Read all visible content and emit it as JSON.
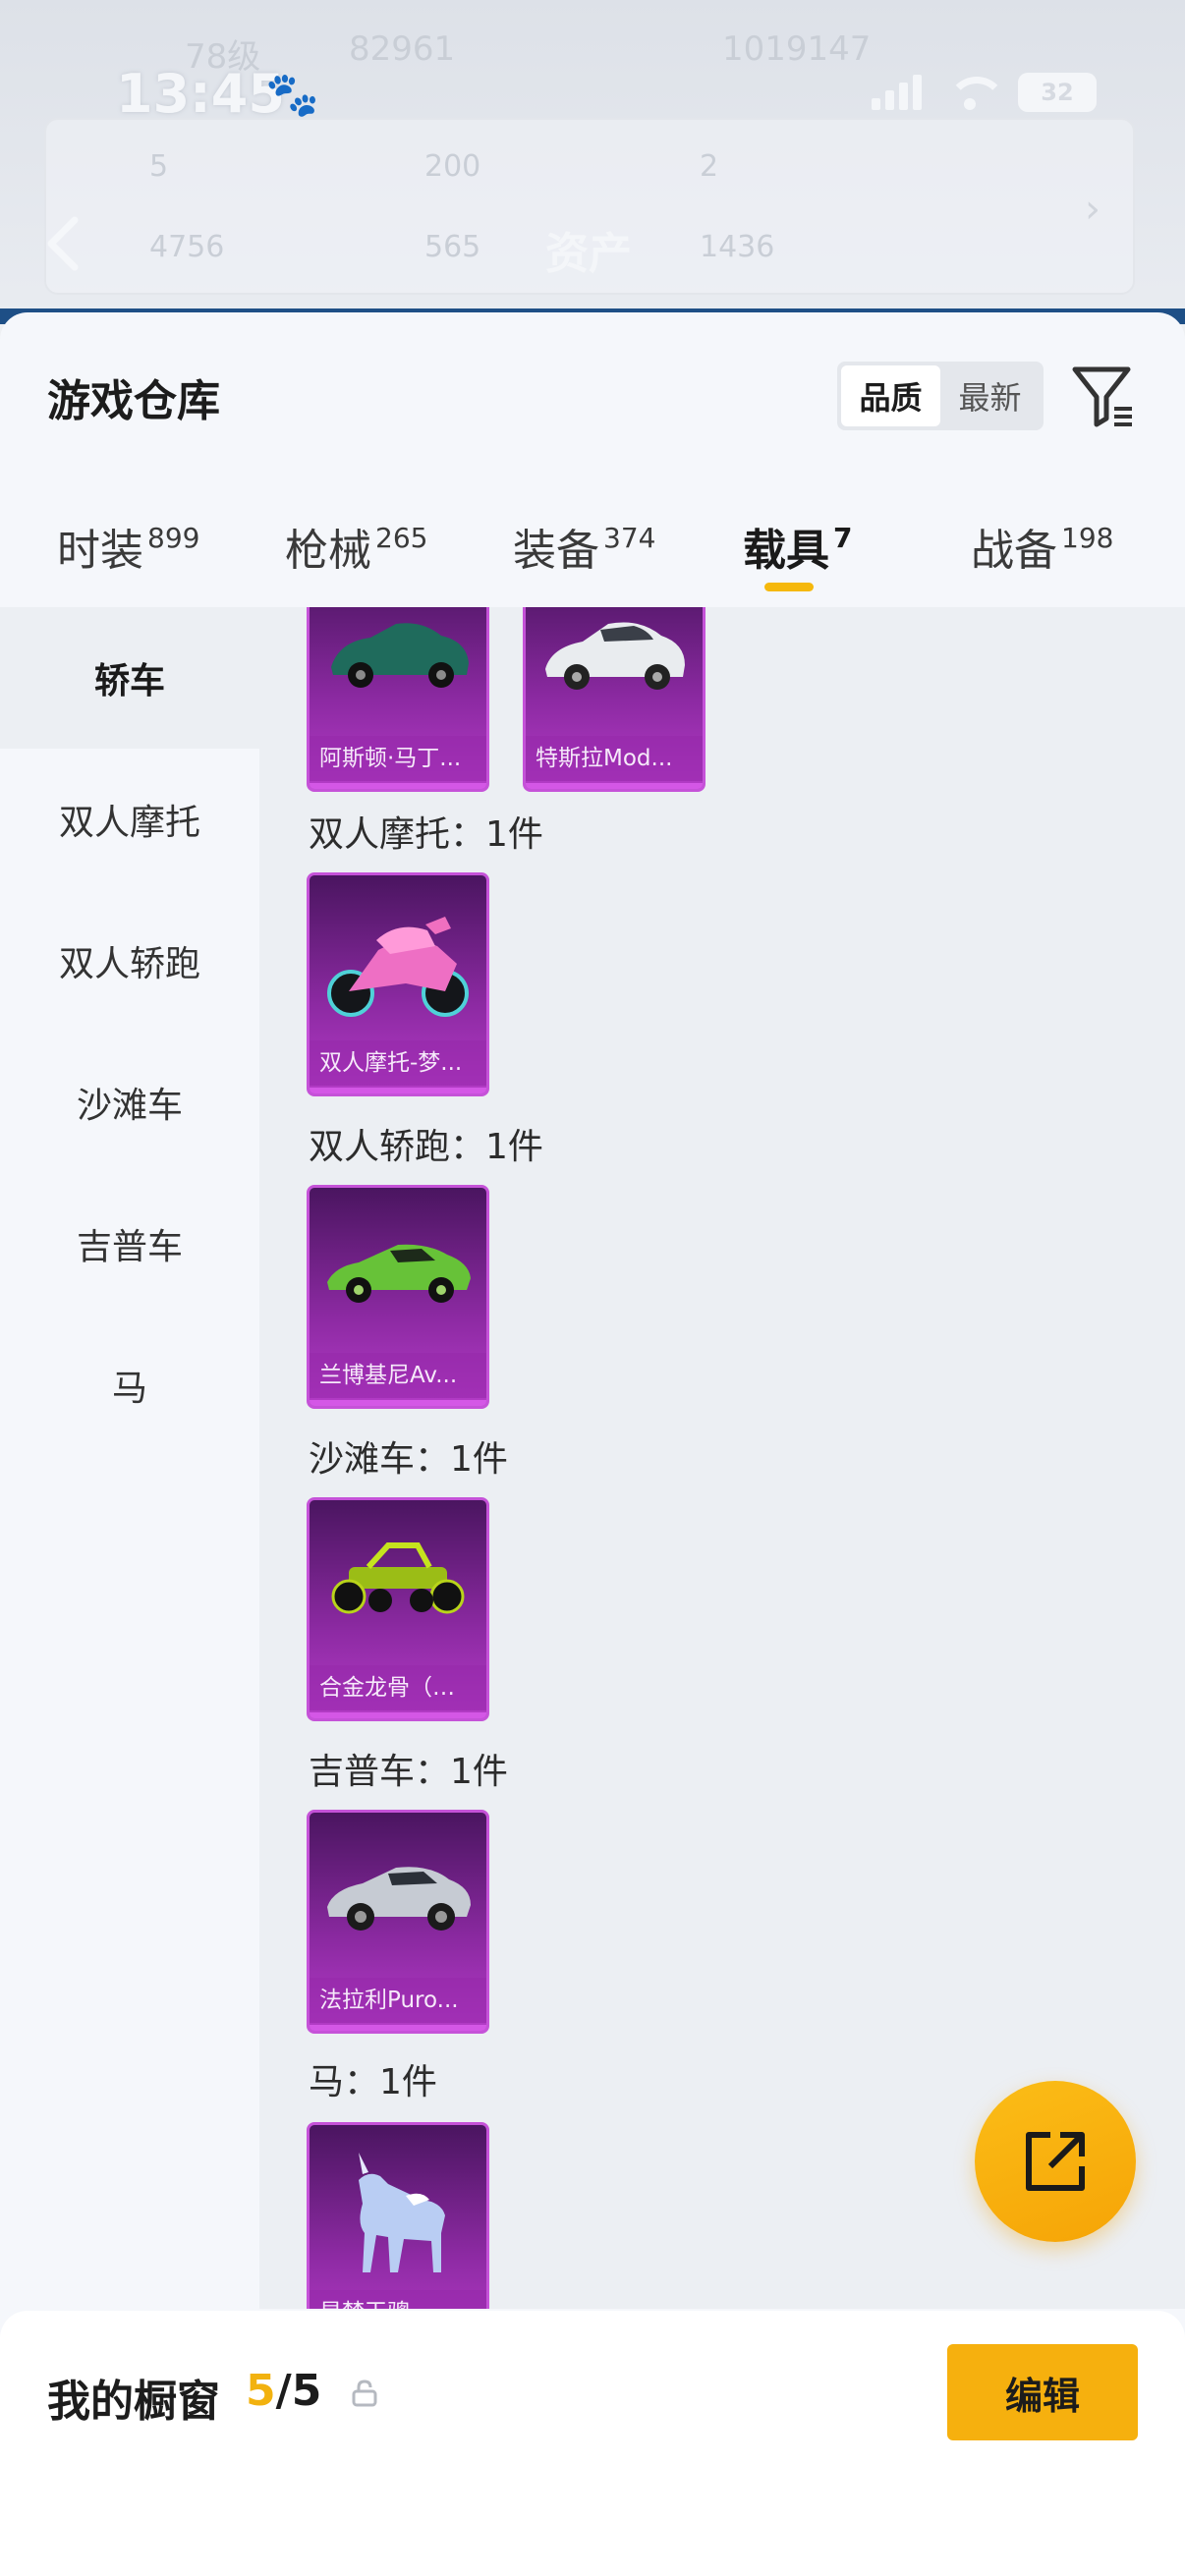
{
  "status_bar": {
    "time": "13:45",
    "battery": "32"
  },
  "background_header": {
    "title": "资产",
    "faded_values": [
      "78级",
      "82961",
      "1019147",
      "5",
      "200",
      "2",
      "4756",
      "565",
      "1436"
    ]
  },
  "sheet": {
    "title": "游戏仓库",
    "sort_options": [
      "品质",
      "最新"
    ],
    "active_sort": "品质"
  },
  "tabs": [
    {
      "label": "时装",
      "count": "899"
    },
    {
      "label": "枪械",
      "count": "265"
    },
    {
      "label": "装备",
      "count": "374"
    },
    {
      "label": "载具",
      "count": "7",
      "active": true
    },
    {
      "label": "战备",
      "count": "198"
    }
  ],
  "sidebar": {
    "items": [
      "轿车",
      "双人摩托",
      "双人轿跑",
      "沙滩车",
      "吉普车",
      "马"
    ],
    "active": "轿车"
  },
  "groups": [
    {
      "label": "",
      "items": [
        "阿斯顿·马丁...",
        "特斯拉Mod..."
      ]
    },
    {
      "label": "双人摩托：1件",
      "items": [
        "双人摩托-梦..."
      ]
    },
    {
      "label": "双人轿跑：1件",
      "items": [
        "兰博基尼Av..."
      ]
    },
    {
      "label": "沙滩车：1件",
      "items": [
        "合金龙骨（绿）"
      ]
    },
    {
      "label": "吉普车：1件",
      "items": [
        "法拉利Puro..."
      ]
    },
    {
      "label": "马：1件",
      "items": [
        "星梦玉骢"
      ]
    }
  ],
  "bottom_bar": {
    "label": "我的橱窗",
    "current": "5",
    "separator": "/",
    "total": "5",
    "edit_label": "编辑"
  },
  "colors": {
    "accent": "#f6b00e",
    "card_purple": "#8d2aa3",
    "sidebar_active": "#eceff3"
  },
  "icons": [
    "back-arrow-icon",
    "paw-icon",
    "signal-icon",
    "wifi-icon",
    "battery-icon",
    "filter-icon",
    "share-icon",
    "lock-icon"
  ]
}
